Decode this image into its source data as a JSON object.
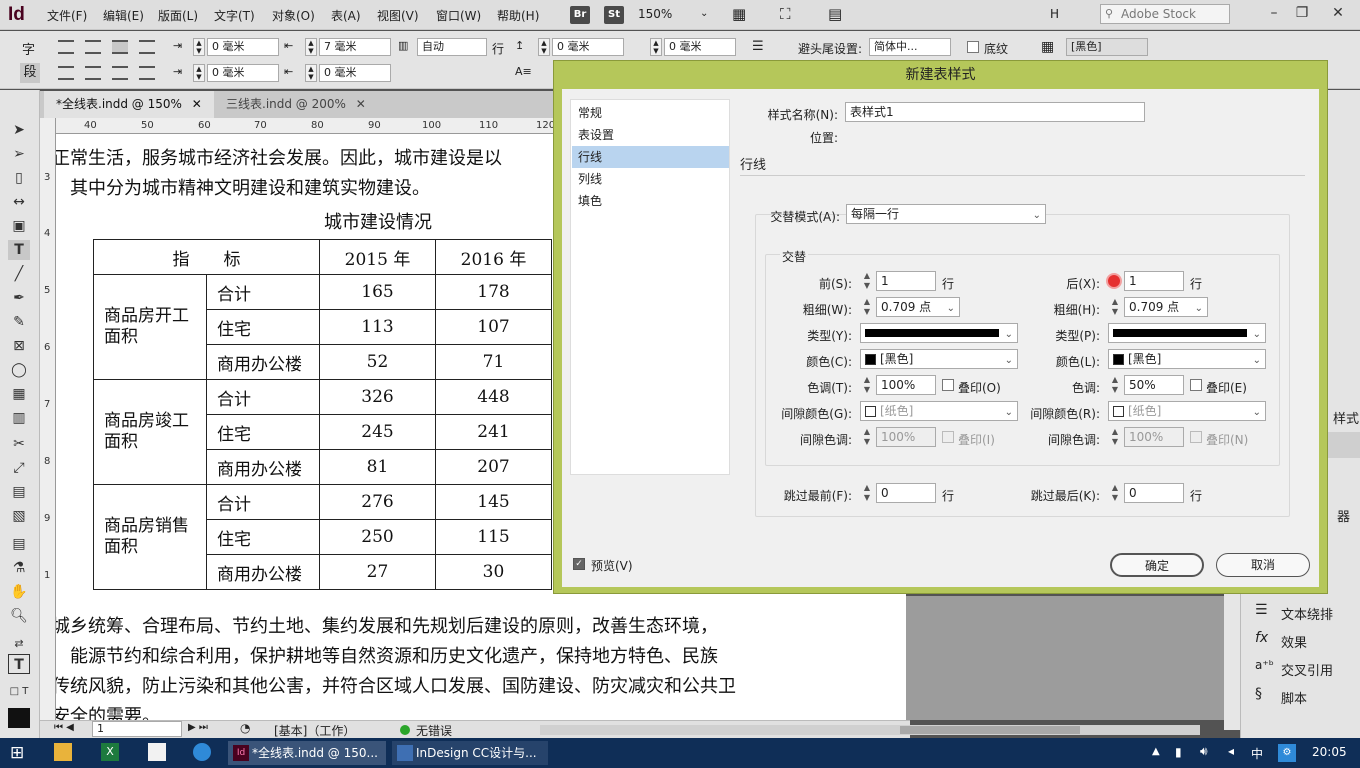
{
  "menubar": {
    "logo": "Id",
    "items": [
      "文件(F)",
      "编辑(E)",
      "版面(L)",
      "文字(T)",
      "对象(O)",
      "表(A)",
      "视图(V)",
      "窗口(W)",
      "帮助(H)"
    ],
    "bridge": "Br",
    "stock_badge": "St",
    "zoom": "150%",
    "workspace": "H",
    "search_placeholder": "Adobe Stock"
  },
  "controlbar": {
    "char_label": "字",
    "para_label": "段",
    "indent_left": "0 毫米",
    "indent_right": "7 毫米",
    "auto": "自动",
    "row_label": "行",
    "space_before": "0 毫米",
    "space_after": "0 毫米",
    "indent_first": "0 毫米",
    "indent_last": "0 毫米",
    "header_footer_label": "避头尾设置:",
    "header_footer_value": "简体中...",
    "shading_label": "底纹",
    "color_value": "[黑色]"
  },
  "tabs": [
    "*全线表.indd @ 150%",
    "三线表.indd @ 200%"
  ],
  "ruler_h": [
    "40",
    "50",
    "60",
    "70",
    "80",
    "90",
    "100",
    "110",
    "120"
  ],
  "ruler_v": [
    "3",
    "4",
    "5",
    "6",
    "7",
    "8",
    "9",
    "1"
  ],
  "document": {
    "line1": "正常生活，服务城市经济社会发展。因此，城市建设是以",
    "line2": "其中分为城市精神文明建设和建筑实物建设。",
    "table_title": "城市建设情况",
    "header": [
      "指　　标",
      "2015 年",
      "2016 年"
    ],
    "groups": [
      {
        "name": "商品房开工面积",
        "rows": [
          [
            "合计",
            "165",
            "178"
          ],
          [
            "住宅",
            "113",
            "107"
          ],
          [
            "商用办公楼",
            "52",
            "71"
          ]
        ]
      },
      {
        "name": "商品房竣工面积",
        "rows": [
          [
            "合计",
            "326",
            "448"
          ],
          [
            "住宅",
            "245",
            "241"
          ],
          [
            "商用办公楼",
            "81",
            "207"
          ]
        ]
      },
      {
        "name": "商品房销售面积",
        "rows": [
          [
            "合计",
            "276",
            "145"
          ],
          [
            "住宅",
            "250",
            "115"
          ],
          [
            "商用办公楼",
            "27",
            "30"
          ]
        ]
      }
    ],
    "line3": "城乡统筹、合理布局、节约土地、集约发展和先规划后建设的原则，改善生态环境，",
    "line4": "能源节约和综合利用，保护耕地等自然资源和历史文化遗产，保持地方特色、民族",
    "line5": "传统风貌，防止污染和其他公害，并符合区域人口发展、国防建设、防灾减灾和公共卫",
    "line6": "安全的需要。"
  },
  "statusbar": {
    "page": "1",
    "style": "[基本]（工作）",
    "errors": "无错误"
  },
  "rightpanel": {
    "items": [
      "文本绕排",
      "效果",
      "交叉引用",
      "脚本"
    ],
    "partial": [
      "样式",
      "器"
    ]
  },
  "dialog": {
    "title": "新建表样式",
    "categories": [
      "常规",
      "表设置",
      "行线",
      "列线",
      "填色"
    ],
    "selected_category": "行线",
    "style_name_label": "样式名称(N):",
    "style_name": "表样式1",
    "location_label": "位置:",
    "section_title": "行线",
    "alternate_mode_label": "交替模式(A):",
    "alternate_mode": "每隔一行",
    "alternate_group": "交替",
    "left": {
      "first_label": "前(S):",
      "first": "1",
      "first_unit": "行",
      "weight_label": "粗细(W):",
      "weight": "0.709 点",
      "type_label": "类型(Y):",
      "color_label": "颜色(C):",
      "color": "[黑色]",
      "tint_label": "色调(T):",
      "tint": "100%",
      "overprint_label": "叠印(O)",
      "gap_color_label": "间隙颜色(G):",
      "gap_color": "[纸色]",
      "gap_tint_label": "间隙色调:",
      "gap_tint": "100%",
      "gap_overprint_label": "叠印(I)"
    },
    "right": {
      "next_label": "后(X):",
      "next": "1",
      "next_unit": "行",
      "weight_label": "粗细(H):",
      "weight": "0.709 点",
      "type_label": "类型(P):",
      "color_label": "颜色(L):",
      "color": "[黑色]",
      "tint_label": "色调:",
      "tint": "50%",
      "overprint_label": "叠印(E)",
      "gap_color_label": "间隙颜色(R):",
      "gap_color": "[纸色]",
      "gap_tint_label": "间隙色调:",
      "gap_tint": "100%",
      "gap_overprint_label": "叠印(N)"
    },
    "skip_first_label": "跳过最前(F):",
    "skip_first": "0",
    "skip_first_unit": "行",
    "skip_last_label": "跳过最后(K):",
    "skip_last": "0",
    "skip_last_unit": "行",
    "preview_label": "预览(V)",
    "ok_label": "确定",
    "cancel_label": "取消"
  },
  "taskbar": {
    "apps": [
      "*全线表.indd @ 150...",
      "InDesign CC设计与..."
    ],
    "ime": "中",
    "time": "20:05"
  },
  "colors": {
    "dialog_frame": "#b5c75a",
    "selection": "#b9d4ef",
    "taskbar": "#0f2e57",
    "cursor_highlight": "#e53030"
  }
}
